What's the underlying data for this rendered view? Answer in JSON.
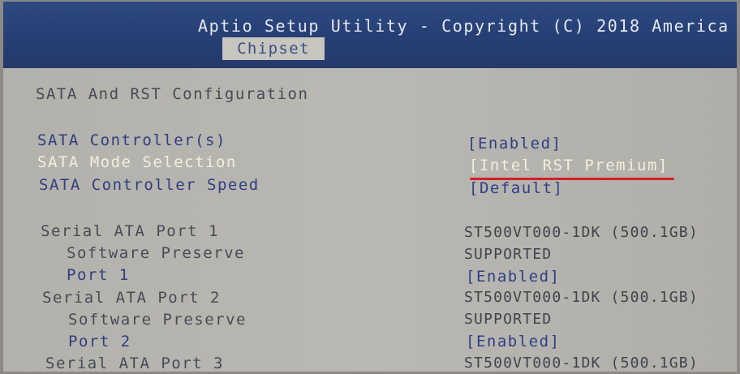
{
  "header": {
    "title": "Aptio Setup Utility - Copyright (C) 2018 America",
    "active_tab": "Chipset"
  },
  "section_title": "SATA And RST Configuration",
  "settings": [
    {
      "label": "SATA Controller(s)",
      "value": "[Enabled]"
    },
    {
      "label": "SATA Mode Selection",
      "value": "[Intel RST Premium]"
    },
    {
      "label": "SATA Controller Speed",
      "value": "[Default]"
    }
  ],
  "ports": [
    {
      "label": "Serial ATA Port 1",
      "device": "ST500VT000-1DK (500.1GB)",
      "preserve_label": "Software Preserve",
      "preserve_value": "SUPPORTED",
      "port_label": "Port 1",
      "port_value": "[Enabled]"
    },
    {
      "label": "Serial ATA Port 2",
      "device": "ST500VT000-1DK (500.1GB)",
      "preserve_label": "Software Preserve",
      "preserve_value": "SUPPORTED",
      "port_label": "Port 2",
      "port_value": "[Enabled]"
    },
    {
      "label": "Serial ATA Port 3",
      "device": "ST500VT000-1DK (500.1GB)"
    }
  ],
  "colors": {
    "header_bg": "#2d4a82",
    "content_bg": "#b4b3ad",
    "selected_text": "#f2efdc",
    "option_text": "#2f3e8a",
    "annotation_underline": "#d61f2a"
  }
}
